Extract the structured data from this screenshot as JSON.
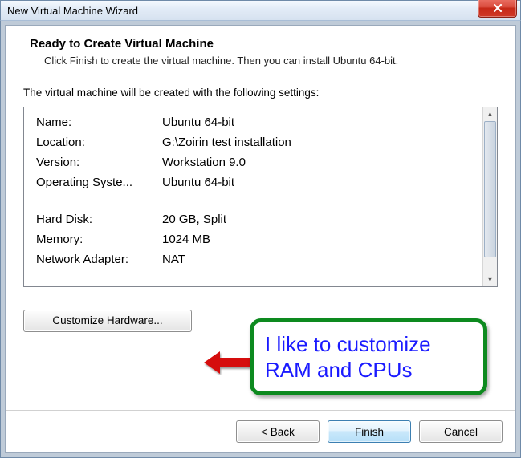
{
  "window": {
    "title": "New Virtual Machine Wizard"
  },
  "header": {
    "title": "Ready to Create Virtual Machine",
    "subtitle": "Click Finish to create the virtual machine. Then you can install Ubuntu 64-bit."
  },
  "intro": "The virtual machine will be created with the following settings:",
  "settings": {
    "name_label": "Name:",
    "name_value": "Ubuntu 64-bit",
    "location_label": "Location:",
    "location_value": "G:\\Zoirin test installation",
    "version_label": "Version:",
    "version_value": "Workstation 9.0",
    "os_label": "Operating Syste...",
    "os_value": "Ubuntu 64-bit",
    "disk_label": "Hard Disk:",
    "disk_value": "20 GB, Split",
    "memory_label": "Memory:",
    "memory_value": "1024 MB",
    "net_label": "Network Adapter:",
    "net_value": "NAT"
  },
  "buttons": {
    "customize": "Customize Hardware...",
    "back": "< Back",
    "finish": "Finish",
    "cancel": "Cancel"
  },
  "annotation": {
    "text": "I like to customize RAM and CPUs"
  }
}
